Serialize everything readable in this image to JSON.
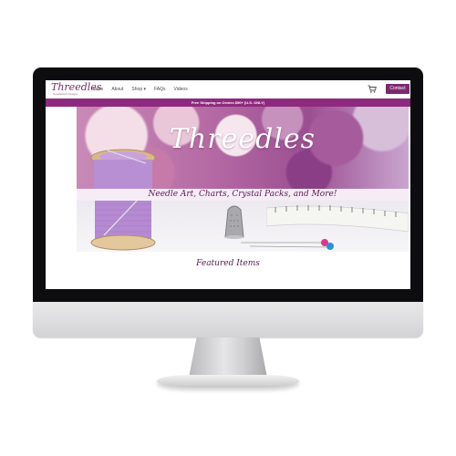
{
  "site": {
    "logo_text": "Threedles",
    "logo_sub": "Needlework Designs",
    "nav": [
      "Home",
      "About",
      "Shop ▾",
      "FAQs",
      "Videos"
    ],
    "contact_label": "Contact",
    "shipping_banner": "Free Shipping on Orders $50+ (U.S. ONLY)"
  },
  "hero": {
    "title": "Threedles",
    "tagline": "Needle Art, Charts, Crystal Packs, and More!"
  },
  "section": {
    "featured_heading": "Featured Items"
  },
  "icons": {
    "cart": "shopping-cart-icon"
  },
  "colors": {
    "brand_purple": "#7b2a6e",
    "banner_purple": "#8e2a7e",
    "tagline_bg": "#f6ecf6"
  }
}
